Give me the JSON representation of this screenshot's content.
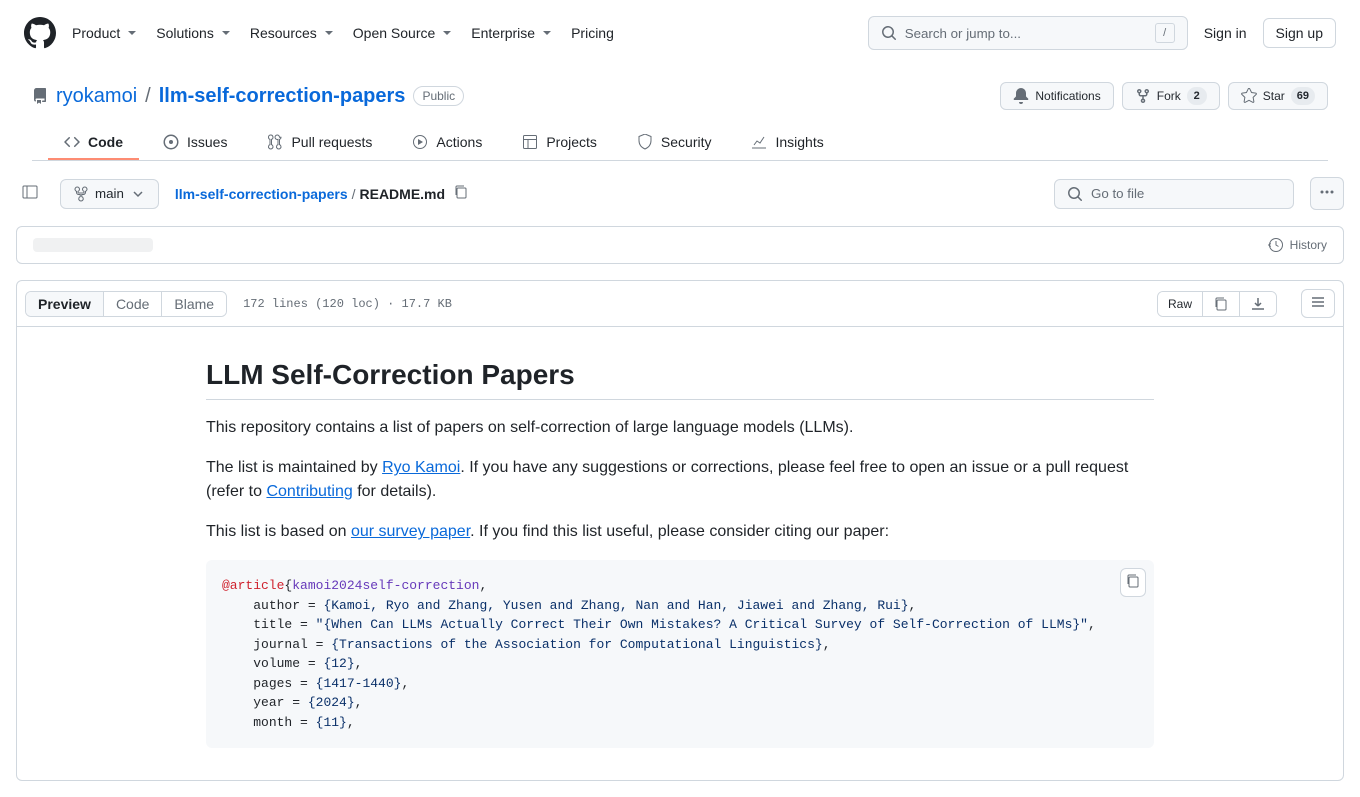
{
  "header": {
    "nav": [
      "Product",
      "Solutions",
      "Resources",
      "Open Source",
      "Enterprise",
      "Pricing"
    ],
    "search_placeholder": "Search or jump to...",
    "sign_in": "Sign in",
    "sign_up": "Sign up"
  },
  "repo": {
    "owner": "ryokamoi",
    "name": "llm-self-correction-papers",
    "visibility": "Public",
    "actions": {
      "notifications": "Notifications",
      "fork": "Fork",
      "fork_count": "2",
      "star": "Star",
      "star_count": "69"
    },
    "tabs": [
      "Code",
      "Issues",
      "Pull requests",
      "Actions",
      "Projects",
      "Security",
      "Insights"
    ]
  },
  "file_nav": {
    "branch": "main",
    "breadcrumb_root": "llm-self-correction-papers",
    "breadcrumb_current": "README.md",
    "gotofile_placeholder": "Go to file",
    "history": "History"
  },
  "file_toolbar": {
    "preview": "Preview",
    "code": "Code",
    "blame": "Blame",
    "fileinfo": "172 lines (120 loc) · 17.7 KB",
    "raw": "Raw"
  },
  "readme": {
    "title": "LLM Self-Correction Papers",
    "intro": "This repository contains a list of papers on self-correction of large language models (LLMs).",
    "maintained_pre": "The list is maintained by ",
    "maintained_link": "Ryo Kamoi",
    "maintained_post": ". If you have any suggestions or corrections, please feel free to open an issue or a pull request (refer to ",
    "contributing_link": "Contributing",
    "maintained_end": " for details).",
    "basedon_pre": "This list is based on ",
    "basedon_link": "our survey paper",
    "basedon_post": ". If you find this list useful, please consider citing our paper:",
    "bibtex": {
      "entry_type": "@article",
      "key": "kamoi2024self-correction",
      "author_label": "author",
      "author_val": "{Kamoi, Ryo and Zhang, Yusen and Zhang, Nan and Han, Jiawei and Zhang, Rui}",
      "title_label": "title",
      "title_val": "\"{When Can LLMs Actually Correct Their Own Mistakes? A Critical Survey of Self-Correction of LLMs}\"",
      "journal_label": "journal",
      "journal_val": "{Transactions of the Association for Computational Linguistics}",
      "volume_label": "volume",
      "volume_val": "{12}",
      "pages_label": "pages",
      "pages_val": "{1417-1440}",
      "year_label": "year",
      "year_val": "{2024}",
      "month_label": "month",
      "month_val": "{11}"
    }
  }
}
